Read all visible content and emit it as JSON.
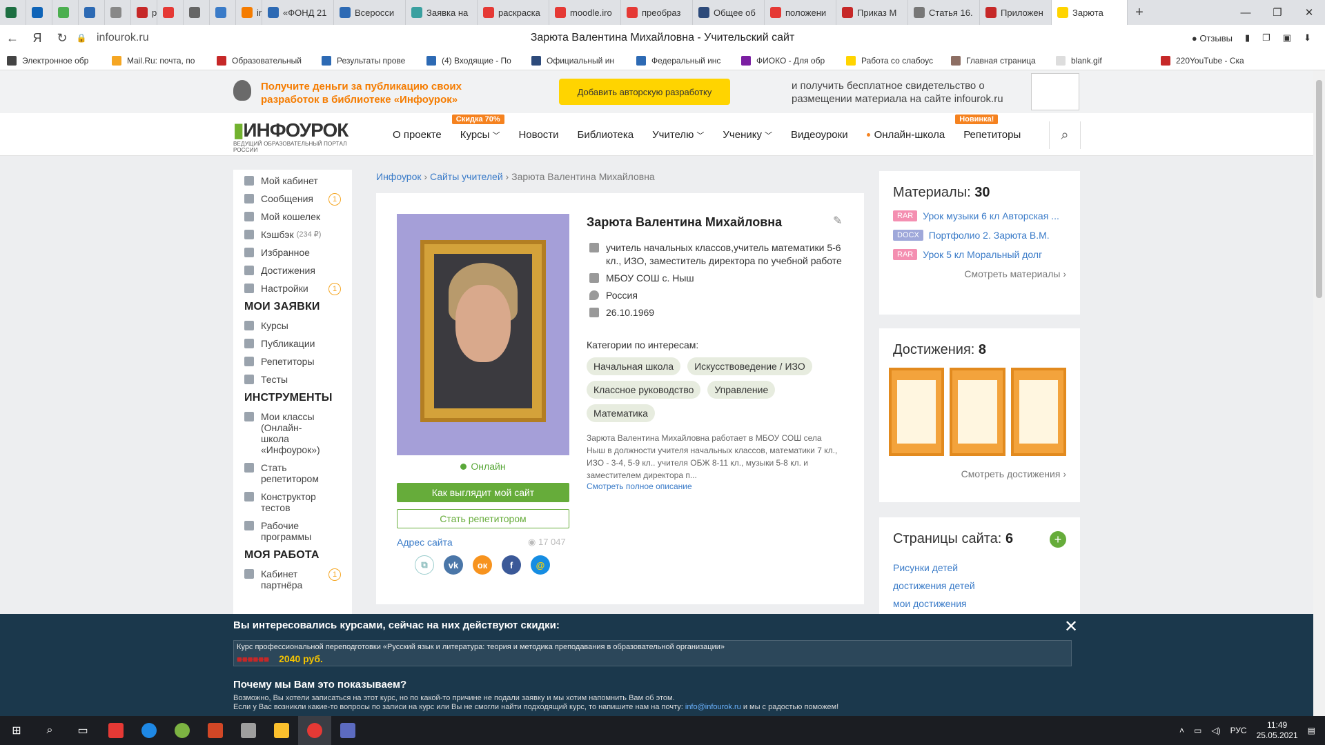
{
  "browser": {
    "tabs": [
      {
        "label": "",
        "color": "#1d6f42",
        "small": true
      },
      {
        "label": "",
        "color": "#0f64b8",
        "small": true
      },
      {
        "label": "",
        "color": "#4caf50",
        "small": true
      },
      {
        "label": "",
        "color": "#2d6ab4",
        "small": true
      },
      {
        "label": "",
        "color": "#888888",
        "small": true
      },
      {
        "label": "pre",
        "color": "#c62828",
        "small": true
      },
      {
        "label": "",
        "color": "#e53935",
        "small": true
      },
      {
        "label": "",
        "color": "#666666",
        "small": true
      },
      {
        "label": "",
        "color": "#3a7bc8",
        "small": true
      },
      {
        "label": "in",
        "color": "#f57c00",
        "small": true
      },
      {
        "label": "«ФОНД 21",
        "color": "#2d6ab4"
      },
      {
        "label": "Всеросси",
        "color": "#2d6ab4"
      },
      {
        "label": "Заявка на",
        "color": "#3aa0a0"
      },
      {
        "label": "раскраска",
        "color": "#e53935"
      },
      {
        "label": "moodle.iro",
        "color": "#e53935"
      },
      {
        "label": "преобраз",
        "color": "#e53935"
      },
      {
        "label": "Общее об",
        "color": "#2d4a7a"
      },
      {
        "label": "положени",
        "color": "#e53935"
      },
      {
        "label": "Приказ М",
        "color": "#c62828"
      },
      {
        "label": "Статья 16.",
        "color": "#777777"
      },
      {
        "label": "Приложен",
        "color": "#c62828"
      },
      {
        "label": "Зарюта",
        "color": "#ffd400",
        "active": true
      }
    ],
    "url": "infourok.ru",
    "page_title": "Зарюта Валентина Михайловна - Учительский сайт",
    "reviews": "Отзывы",
    "bookmarks": [
      {
        "label": "Электронное обр",
        "color": "#444444"
      },
      {
        "label": "Mail.Ru: почта, по",
        "color": "#f5a623"
      },
      {
        "label": "Образовательный",
        "color": "#c62828"
      },
      {
        "label": "Результаты прове",
        "color": "#2d6ab4"
      },
      {
        "label": "(4) Входящие - По",
        "color": "#2d6ab4"
      },
      {
        "label": "Официальный ин",
        "color": "#2d4a7a"
      },
      {
        "label": "Федеральный инс",
        "color": "#2d6ab4"
      },
      {
        "label": "ФИОКО - Для обр",
        "color": "#7b1fa2"
      },
      {
        "label": "Работа со слабоус",
        "color": "#ffd400"
      },
      {
        "label": "Главная страница",
        "color": "#8d6e63"
      },
      {
        "label": "blank.gif",
        "color": "#dddddd"
      },
      {
        "label": "220YouTube - Ска",
        "color": "#c62828"
      }
    ]
  },
  "promo": {
    "text": "Получите деньги за публикацию своих разработок в библиотеке «Инфоурок»",
    "button": "Добавить авторскую разработку",
    "text2": "и получить бесплатное свидетельство о размещении материала на сайте infourok.ru"
  },
  "header": {
    "logo": "ИНФОУРОК",
    "logo_sub": "ВЕДУЩИЙ ОБРАЗОВАТЕЛЬНЫЙ ПОРТАЛ РОССИИ",
    "menu": [
      {
        "label": "О проекте"
      },
      {
        "label": "Курсы",
        "badge": "Скидка 70%",
        "chev": true
      },
      {
        "label": "Новости"
      },
      {
        "label": "Библиотека"
      },
      {
        "label": "Учителю",
        "chev": true
      },
      {
        "label": "Ученику",
        "chev": true
      },
      {
        "label": "Видеоуроки"
      },
      {
        "label": "Онлайн-школа",
        "dot": true
      },
      {
        "label": "Репетиторы",
        "badge": "Новинка!"
      }
    ]
  },
  "sidebar": {
    "items": [
      {
        "label": "Мой кабинет"
      },
      {
        "label": "Сообщения",
        "count": "1"
      },
      {
        "label": "Мой кошелек"
      },
      {
        "label": "Кэшбэк",
        "small": "(234 ₽)"
      },
      {
        "label": "Избранное"
      },
      {
        "label": "Достижения"
      },
      {
        "label": "Настройки",
        "count": "1"
      }
    ],
    "h1": "МОИ ЗАЯВКИ",
    "items2": [
      {
        "label": "Курсы"
      },
      {
        "label": "Публикации"
      },
      {
        "label": "Репетиторы"
      },
      {
        "label": "Тесты"
      }
    ],
    "h2": "ИНСТРУМЕНТЫ",
    "items3": [
      {
        "label": "Мои классы (Онлайн-школа «Инфоурок»)"
      },
      {
        "label": "Стать репетитором"
      },
      {
        "label": "Конструктор тестов"
      },
      {
        "label": "Рабочие программы"
      }
    ],
    "h3": "МОЯ РАБОТА",
    "items4": [
      {
        "label": "Кабинет партнёра",
        "count": "1"
      }
    ]
  },
  "breadcrumb": {
    "c1": "Инфоурок",
    "c2": "Сайты учителей",
    "c3": "Зарюта Валентина Михайловна",
    "sep": "›"
  },
  "profile": {
    "name": "Зарюта Валентина Михайловна",
    "status": "Онлайн",
    "btn_site": "Как выглядит мой сайт",
    "btn_tutor": "Стать репетитором",
    "site_addr": "Адрес сайта",
    "views": "17 047",
    "info": [
      "учитель начальных классов,учитель математики 5-6 кл., ИЗО, заместитель директора по учебной работе",
      "МБОУ СОШ с. Ныш",
      "Россия",
      "26.10.1969"
    ],
    "categories_label": "Категории по интересам:",
    "tags": [
      "Начальная школа",
      "Искусствоведение / ИЗО",
      "Классное руководство",
      "Управление",
      "Математика"
    ],
    "description": "Зарюта Валентина Михайловна работает в МБОУ СОШ села Ныш в должности учителя начальных классов, математики 7 кл., ИЗО - 3-4, 5-9 кл.. учителя ОБЖ 8-11 кл., музыки 5-8 кл. и заместителем директора п...",
    "more": "Смотреть полное описание"
  },
  "materials": {
    "title": "Материалы:",
    "count": "30",
    "items": [
      {
        "type": "RAR",
        "color": "#f48fb1",
        "label": "Урок музыки 6 кл Авторская ..."
      },
      {
        "type": "DOCX",
        "color": "#9fa8da",
        "label": "Портфолио 2. Зарюта В.М."
      },
      {
        "type": "RAR",
        "color": "#f48fb1",
        "label": "Урок 5 кл Моральный долг"
      }
    ],
    "link": "Смотреть материалы ›"
  },
  "achievements": {
    "title": "Достижения:",
    "count": "8",
    "link": "Смотреть достижения ›"
  },
  "pages": {
    "title": "Страницы сайта:",
    "count": "6",
    "items": [
      "Рисунки детей",
      "достижения детей",
      "мои достижения"
    ]
  },
  "popup": {
    "title": "Вы интересовались курсами, сейчас на них действуют скидки:",
    "course": "Курс профессиональной переподготовки «Русский язык и литература: теория и методика преподавания в образовательной организации»",
    "price": "2040 руб.",
    "why": "Почему мы Вам это показываем?",
    "text1": "Возможно, Вы хотели записаться на этот курс, но по какой-то причине не подали заявку и мы хотим напомнить Вам об этом.",
    "text2": "Если у Вас возникли какие-то вопросы по записи на курс или Вы не смогли найти подходящий курс, то напишите нам на почту:",
    "email": "info@infourok.ru",
    "text3": "и мы с радостью поможем!"
  },
  "taskbar": {
    "lang": "РУС",
    "time": "11:49",
    "date": "25.05.2021"
  }
}
